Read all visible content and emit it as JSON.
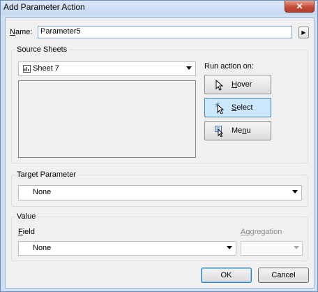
{
  "window": {
    "title": "Add Parameter Action",
    "close_icon": "close-icon"
  },
  "name": {
    "label": "Name:",
    "value": "Parameter5",
    "menu_icon": "triangle-right-icon"
  },
  "source_sheets": {
    "group_title": "Source Sheets",
    "selected_sheet": "Sheet 7",
    "sheet_icon": "worksheet-icon",
    "run_action_label": "Run action on:",
    "buttons": [
      {
        "label": "Hover",
        "icon": "pointer-icon",
        "selected": false
      },
      {
        "label": "Select",
        "icon": "click-pointer-icon",
        "selected": true
      },
      {
        "label": "Menu",
        "icon": "menu-pointer-icon",
        "selected": false
      }
    ]
  },
  "target_parameter": {
    "group_title": "Target Parameter",
    "value": "None"
  },
  "value": {
    "group_title": "Value",
    "field_label": "Field",
    "field_value": "None",
    "aggregation_label": "Aggregation",
    "aggregation_value": ""
  },
  "footer": {
    "ok_label": "OK",
    "cancel_label": "Cancel"
  },
  "colors": {
    "window_frame": "#cfe0f3",
    "close_button": "#c74b3a",
    "selected_button": "#cce8ff"
  }
}
